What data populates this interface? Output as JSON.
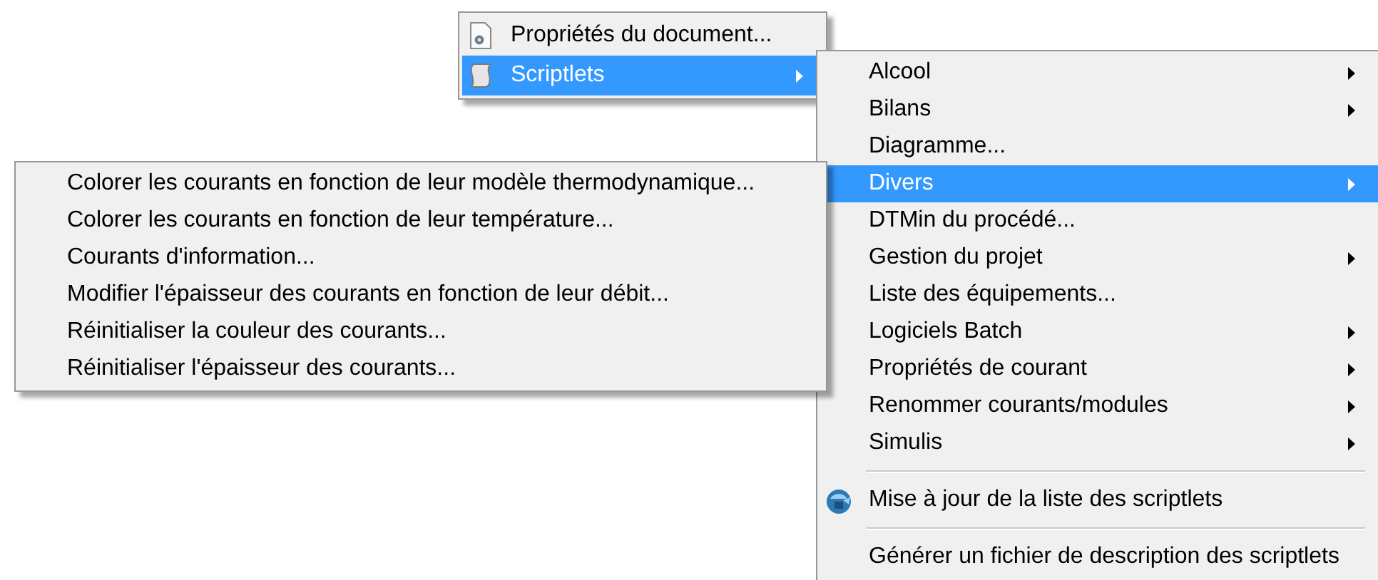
{
  "menus": [
    {
      "items": [
        {
          "kind": "command",
          "label": "Propriétés du document...",
          "icon": true,
          "submenu": false,
          "selected": false
        },
        {
          "kind": "command",
          "label": "Scriptlets",
          "icon": true,
          "submenu": true,
          "selected": true
        }
      ]
    },
    {
      "items": [
        {
          "kind": "command",
          "label": "Alcool",
          "icon": false,
          "submenu": true,
          "selected": false
        },
        {
          "kind": "command",
          "label": "Bilans",
          "icon": false,
          "submenu": true,
          "selected": false
        },
        {
          "kind": "command",
          "label": "Diagramme...",
          "icon": false,
          "submenu": false,
          "selected": false
        },
        {
          "kind": "command",
          "label": "Divers",
          "icon": false,
          "submenu": true,
          "selected": true
        },
        {
          "kind": "command",
          "label": "DTMin du procédé...",
          "icon": false,
          "submenu": false,
          "selected": false
        },
        {
          "kind": "command",
          "label": "Gestion du projet",
          "icon": false,
          "submenu": true,
          "selected": false
        },
        {
          "kind": "command",
          "label": "Liste des équipements...",
          "icon": false,
          "submenu": false,
          "selected": false
        },
        {
          "kind": "command",
          "label": "Logiciels Batch",
          "icon": false,
          "submenu": true,
          "selected": false
        },
        {
          "kind": "command",
          "label": "Propriétés de courant",
          "icon": false,
          "submenu": true,
          "selected": false
        },
        {
          "kind": "command",
          "label": "Renommer courants/modules",
          "icon": false,
          "submenu": true,
          "selected": false
        },
        {
          "kind": "command",
          "label": "Simulis",
          "icon": false,
          "submenu": true,
          "selected": false
        },
        {
          "kind": "separator"
        },
        {
          "kind": "command",
          "label": "Mise à jour de la liste des scriptlets",
          "icon": true,
          "submenu": false,
          "selected": false
        },
        {
          "kind": "separator"
        },
        {
          "kind": "command",
          "label": "Générer un fichier de description des scriptlets",
          "icon": false,
          "submenu": false,
          "selected": false
        }
      ]
    },
    {
      "items": [
        {
          "kind": "command",
          "label": "Colorer les courants en fonction de leur modèle thermodynamique...",
          "icon": false,
          "submenu": false,
          "selected": false
        },
        {
          "kind": "command",
          "label": "Colorer les courants en fonction de leur température...",
          "icon": false,
          "submenu": false,
          "selected": false
        },
        {
          "kind": "command",
          "label": "Courants d'information...",
          "icon": false,
          "submenu": false,
          "selected": false
        },
        {
          "kind": "command",
          "label": "Modifier l'épaisseur des courants en fonction de leur débit...",
          "icon": false,
          "submenu": false,
          "selected": false
        },
        {
          "kind": "command",
          "label": "Réinitialiser la couleur des courants...",
          "icon": false,
          "submenu": false,
          "selected": false
        },
        {
          "kind": "command",
          "label": "Réinitialiser l'épaisseur des courants...",
          "icon": false,
          "submenu": false,
          "selected": false
        }
      ]
    }
  ]
}
